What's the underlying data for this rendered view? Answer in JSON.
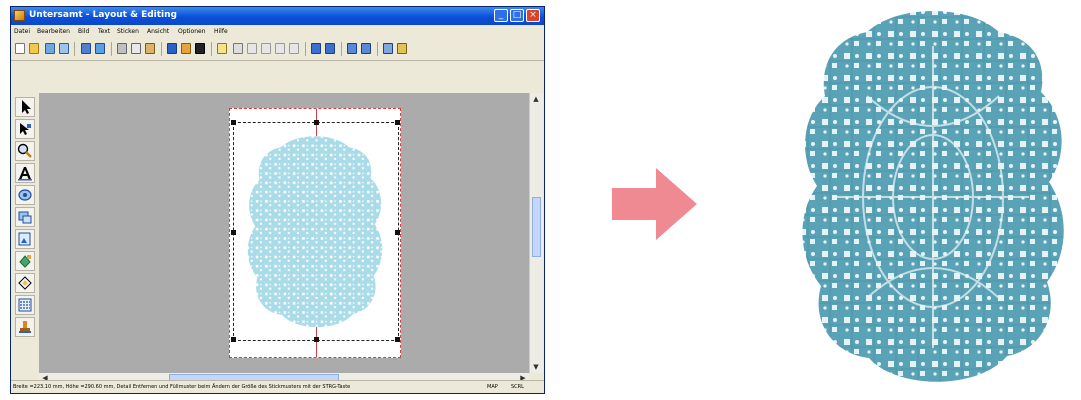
{
  "window": {
    "title": "Untersamt - Layout & Editing",
    "controls": [
      "_",
      "□",
      "×"
    ]
  },
  "menu": [
    "Datei",
    "Bearbeiten",
    "Bild",
    "Text",
    "Sticken",
    "Ansicht",
    "Optionen",
    "Hilfe"
  ],
  "toolbar_icons": [
    "new-icon",
    "open-icon",
    "save-icon",
    "print-icon",
    "undo-icon",
    "redo-icon",
    "cut-icon",
    "copy-icon",
    "paste-icon",
    "import-icon",
    "zoom-icon",
    "transfer-icon"
  ],
  "tools": [
    "select-arrow-icon",
    "point-edit-icon",
    "zoom-tool-icon",
    "text-tool-icon",
    "shape-tool-icon",
    "rectangle-tool-icon",
    "image-tool-icon",
    "fill-tool-icon",
    "eraser-tool-icon",
    "stitch-tool-icon",
    "stamp-tool-icon"
  ],
  "statusbar": {
    "text": "Breite =223.10 mm, Höhe =290.60 mm, Detail Entfernen und Füllmuster beim Ändern der Größe des Stickmusters mit der STRG-Taste",
    "right": [
      "MAP",
      "SCRL"
    ]
  },
  "colors": {
    "lace": "#5aa3b7",
    "lace_preview": "#a9dbe8",
    "arrow": "#ef8a93",
    "titlebar": "#0b4fd8",
    "canvas": "#ababab"
  }
}
